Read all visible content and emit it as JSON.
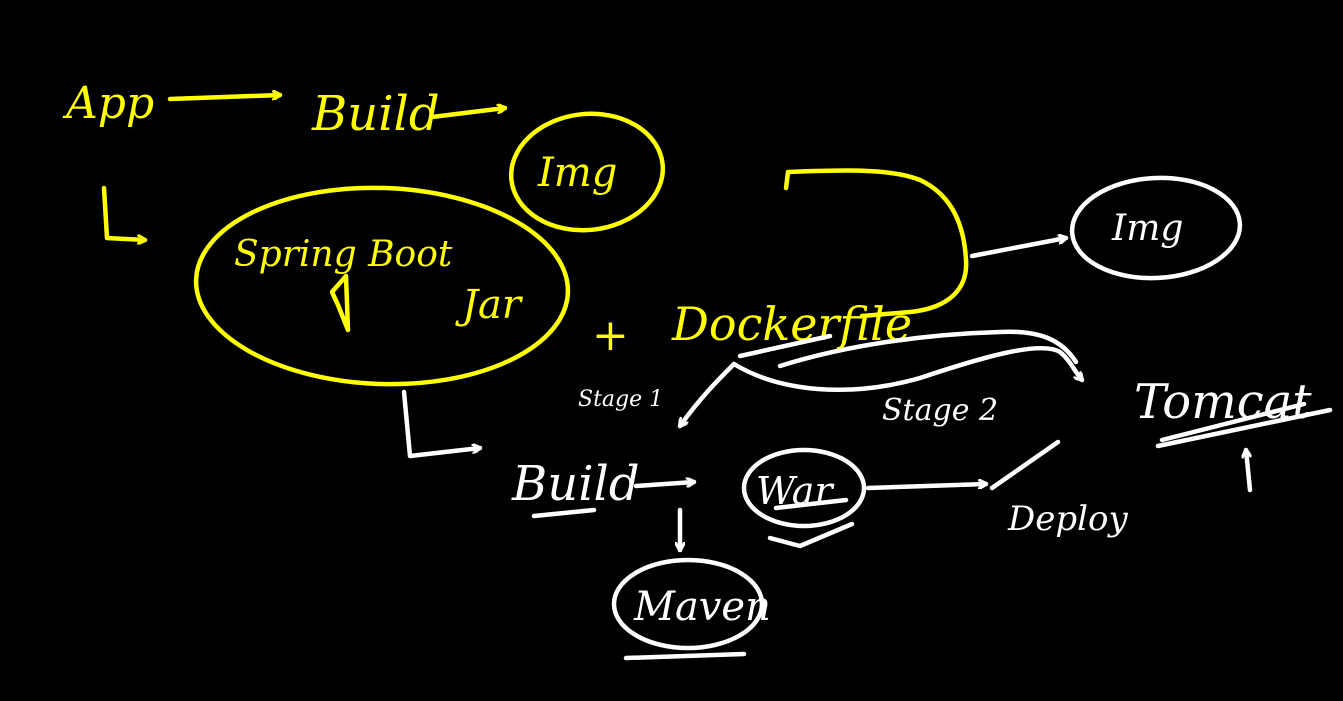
{
  "colors": {
    "background": "#000000",
    "yellow_ink": "#ffff00",
    "white_ink": "#ffffff"
  },
  "nodes": {
    "app": "App",
    "build_top": "Build",
    "img_top": "Img",
    "spring_boot": "Spring Boot",
    "jar": "Jar",
    "plus": "+",
    "dockerfile": "Dockerfile",
    "img_right": "Img",
    "stage1": "Stage 1",
    "stage2": "Stage 2",
    "tomcat": "Tomcat",
    "build_bottom": "Build",
    "war": "War",
    "deploy": "Deploy",
    "maven": "Maven"
  }
}
